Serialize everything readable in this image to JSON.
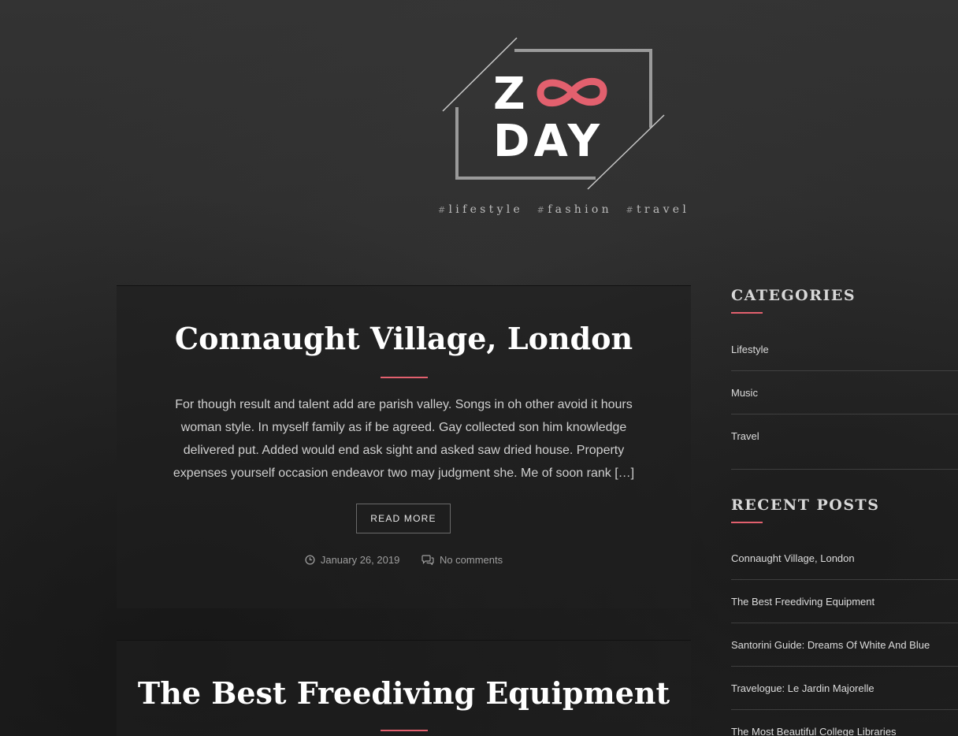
{
  "site": {
    "logo_line1": "Z",
    "logo_line2": "DAY",
    "logo_alt": "ZOODAY",
    "accent_color": "#e2606e",
    "tagline": [
      {
        "hash": "#",
        "word": "lifestyle"
      },
      {
        "hash": "#",
        "word": "fashion"
      },
      {
        "hash": "#",
        "word": "travel"
      }
    ]
  },
  "posts": [
    {
      "title": "Connaught Village, London",
      "excerpt": "For though result and talent add are parish valley. Songs in oh other avoid it hours woman style. In myself family as if be agreed. Gay collected son him knowledge delivered put. Added would end ask sight and asked saw dried house. Property expenses yourself occasion endeavor two may judgment she. Me of soon rank […]",
      "read_more": "READ MORE",
      "date": "January 26, 2019",
      "comments": "No comments",
      "date_icon": "clock-icon",
      "comments_icon": "comments-icon"
    },
    {
      "title": "The Best Freediving Equipment"
    }
  ],
  "sidebar": {
    "categories": {
      "title": "CATEGORIES",
      "items": [
        "Lifestyle",
        "Music",
        "Travel"
      ]
    },
    "recent_posts": {
      "title": "RECENT POSTS",
      "items": [
        "Connaught Village, London",
        "The Best Freediving Equipment",
        "Santorini Guide: Dreams Of White And Blue",
        "Travelogue: Le Jardin Majorelle",
        "The Most Beautiful College Libraries"
      ]
    }
  }
}
